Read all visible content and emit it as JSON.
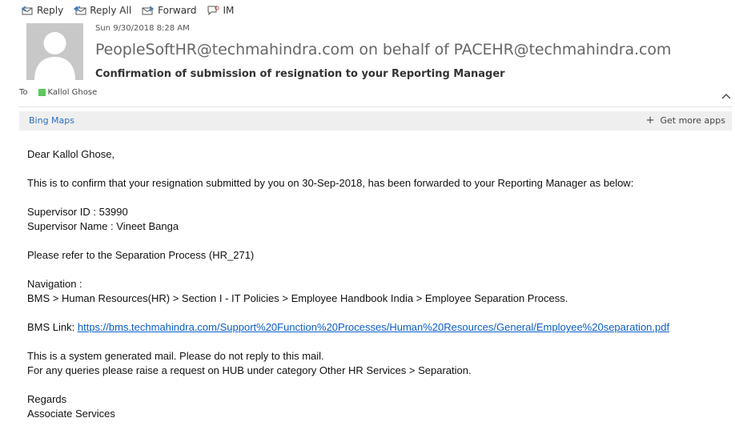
{
  "toolbar": {
    "reply": "Reply",
    "reply_all": "Reply All",
    "forward": "Forward",
    "im": "IM"
  },
  "header": {
    "date": "Sun 9/30/2018 8:28 AM",
    "sender": "PeopleSoftHR@techmahindra.com on behalf of PACEHR@techmahindra.com",
    "subject": "Confirmation of submission of resignation to your Reporting Manager",
    "to_label": "To",
    "recipient": "Kallol Ghose",
    "presence_color": "#5cc85c"
  },
  "apps_bar": {
    "bing_maps": "Bing Maps",
    "get_more_apps": "Get more apps"
  },
  "body": {
    "greeting": "Dear Kallol Ghose,",
    "confirm_line": "This is to confirm that your resignation submitted by you on  30-Sep-2018, has been forwarded to your Reporting Manager as below:",
    "supervisor_id": "Supervisor ID : 53990",
    "supervisor_name": "Supervisor Name : Vineet Banga",
    "refer_line": "Please refer to the Separation Process (HR_271)",
    "navigation_label": "Navigation :",
    "navigation_path": "BMS > Human Resources(HR) > Section I - IT Policies > Employee Handbook India > Employee Separation Process.",
    "bms_link_label": "BMS Link: ",
    "bms_link_url": "https://bms.techmahindra.com/Support%20Function%20Processes/Human%20Resources/General/Employee%20separation.pdf",
    "system_line": "This is a system generated mail. Please do not reply to this mail.",
    "queries_line": "For any queries please raise a request on HUB under category Other HR Services > Separation.",
    "regards": "Regards",
    "signature": "Associate Services"
  },
  "colors": {
    "link": "#0b5ec9",
    "bing_link": "#2a6ebb",
    "apps_bar_bg": "#efefef"
  }
}
